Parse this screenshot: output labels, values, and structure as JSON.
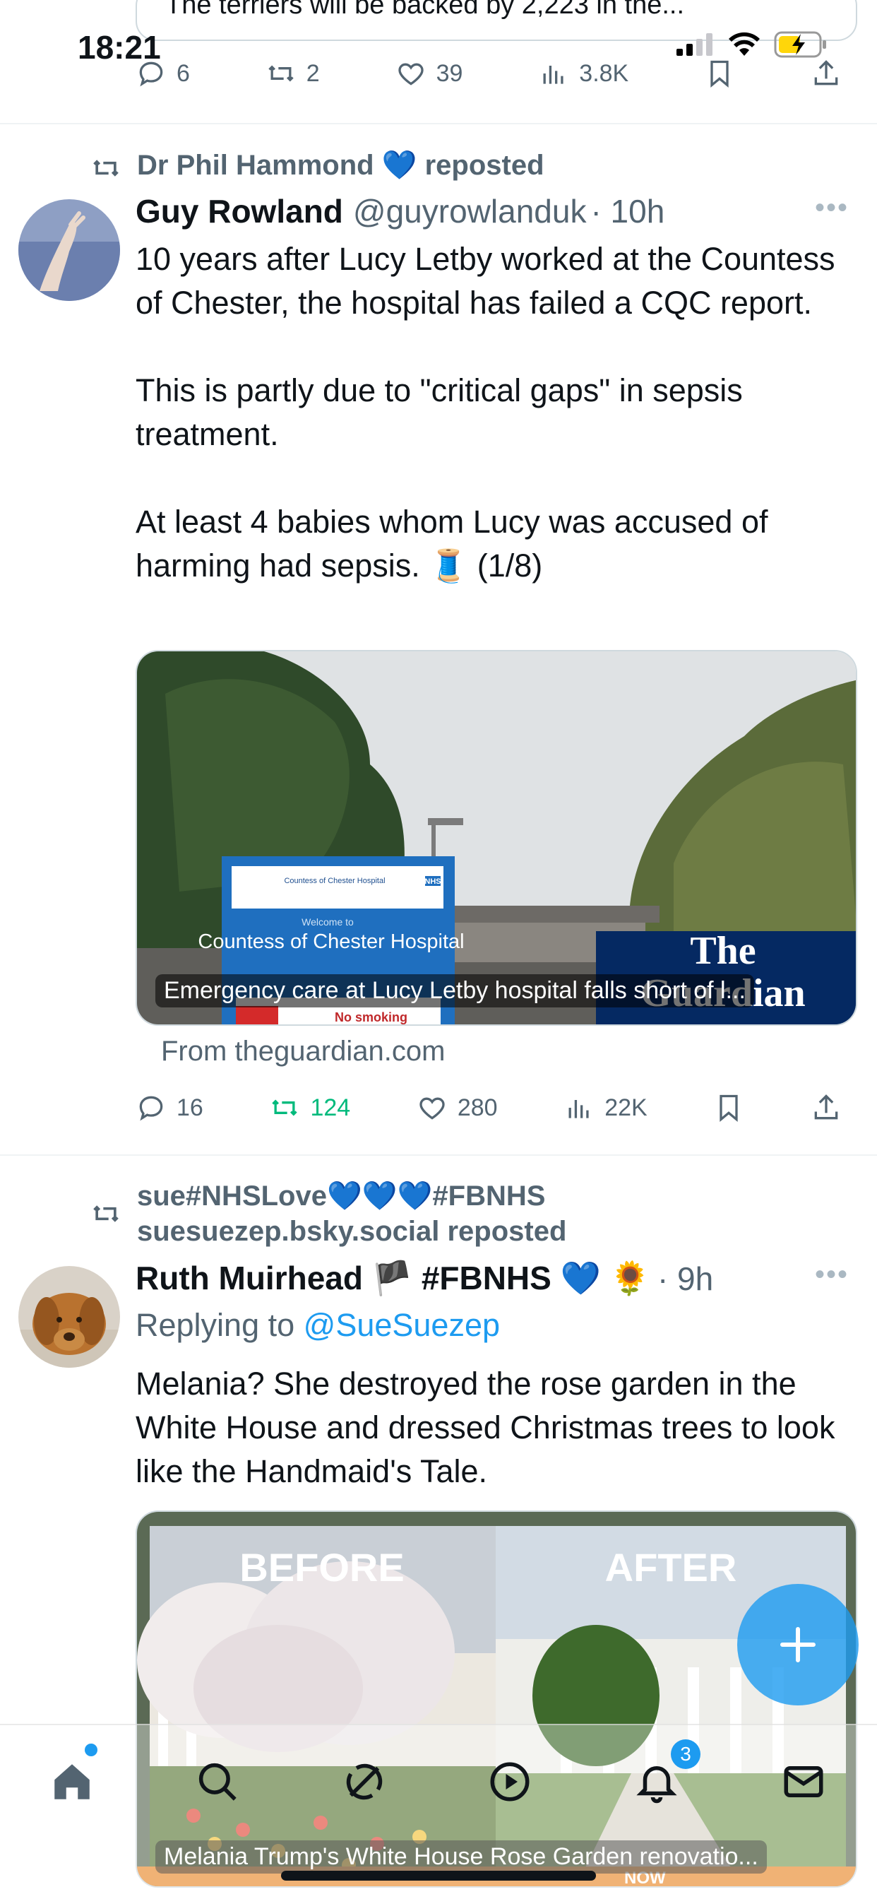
{
  "status_bar": {
    "time": "18:21"
  },
  "top_partial_tweet": {
    "text": "The terriers will be backed by 2,223 in the...",
    "actions": {
      "replies": "6",
      "reposts": "2",
      "likes": "39",
      "views": "3.8K"
    }
  },
  "tweet1": {
    "repost_by": "Dr Phil Hammond 💙 reposted",
    "name": "Guy Rowland",
    "handle": "@guyrowlanduk",
    "time": "· 10h",
    "text": [
      "10 years after Lucy Letby worked at the Countess of Chester, the hospital has failed a CQC report.",
      "This is partly due to \"critical gaps\" in sepsis treatment.",
      "At least 4 babies whom Lucy was accused of harming had sepsis. 🧵 (1/8)"
    ],
    "card": {
      "sign_small": "Countess of Chester Hospital",
      "sign_nhs": "NHS",
      "sign_welcome": "Welcome to",
      "sign_main": "Countess of Chester Hospital",
      "sign_nosmoking": "No smoking",
      "logo_line1": "The",
      "logo_line2": "Guardian",
      "caption": "Emergency care at Lucy Letby hospital falls short of l...",
      "source": "From theguardian.com"
    },
    "actions": {
      "replies": "16",
      "reposts": "124",
      "likes": "280",
      "views": "22K"
    }
  },
  "tweet2": {
    "repost_line1": "sue#NHSLove💙💙💙#FBNHS",
    "repost_line2": "suesuezep.bsky.social reposted",
    "name": "Ruth Muirhead 🏴 #FBNHS 💙 🌻",
    "time": "· 9h",
    "replying_prefix": "Replying to ",
    "replying_handle": "@SueSuezep",
    "text": "Melania? She destroyed the rose garden in the White House and dressed Christmas trees to look like the Handmaid's Tale.",
    "card": {
      "label_before": "BEFORE",
      "label_after": "AFTER",
      "caption": "Melania Trump's White House Rose Garden renovatio...",
      "ticker": "NOW"
    }
  },
  "nav": {
    "items": [
      "home-icon",
      "search-icon",
      "grok-icon",
      "video-icon",
      "notifications-icon",
      "messages-icon"
    ],
    "notification_count": "3"
  },
  "colors": {
    "accent": "#1d9bf0",
    "retweet_green": "#00ba7c",
    "muted": "#536471"
  }
}
